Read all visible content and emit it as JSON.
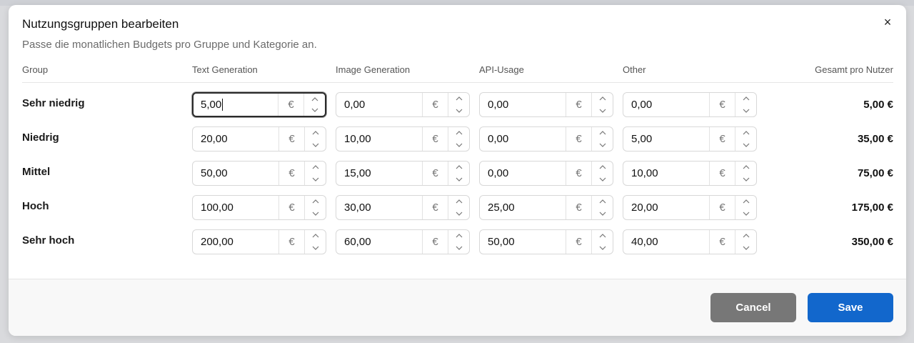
{
  "dialog": {
    "title": "Nutzungsgruppen bearbeiten",
    "subtitle": "Passe die monatlichen Budgets pro Gruppe und Kategorie an.",
    "close_icon": "×"
  },
  "table": {
    "headers": {
      "group": "Group",
      "text_generation": "Text Generation",
      "image_generation": "Image Generation",
      "api_usage": "API-Usage",
      "other": "Other",
      "total": "Gesamt pro Nutzer"
    },
    "currency_symbol": "€",
    "rows": [
      {
        "label": "Sehr niedrig",
        "text": "5,00",
        "image": "0,00",
        "api": "0,00",
        "other": "0,00",
        "total": "5,00 €"
      },
      {
        "label": "Niedrig",
        "text": "20,00",
        "image": "10,00",
        "api": "0,00",
        "other": "5,00",
        "total": "35,00 €"
      },
      {
        "label": "Mittel",
        "text": "50,00",
        "image": "15,00",
        "api": "0,00",
        "other": "10,00",
        "total": "75,00 €"
      },
      {
        "label": "Hoch",
        "text": "100,00",
        "image": "30,00",
        "api": "25,00",
        "other": "20,00",
        "total": "175,00 €"
      },
      {
        "label": "Sehr hoch",
        "text": "200,00",
        "image": "60,00",
        "api": "50,00",
        "other": "40,00",
        "total": "350,00 €"
      }
    ],
    "focused_cell": "rows.0.text"
  },
  "footer": {
    "cancel_label": "Cancel",
    "save_label": "Save"
  },
  "colors": {
    "primary": "#1267cc",
    "secondary": "#777777"
  },
  "icons": {
    "close": "close-icon",
    "spin_up": "chevron-up-icon",
    "spin_down": "chevron-down-icon"
  }
}
